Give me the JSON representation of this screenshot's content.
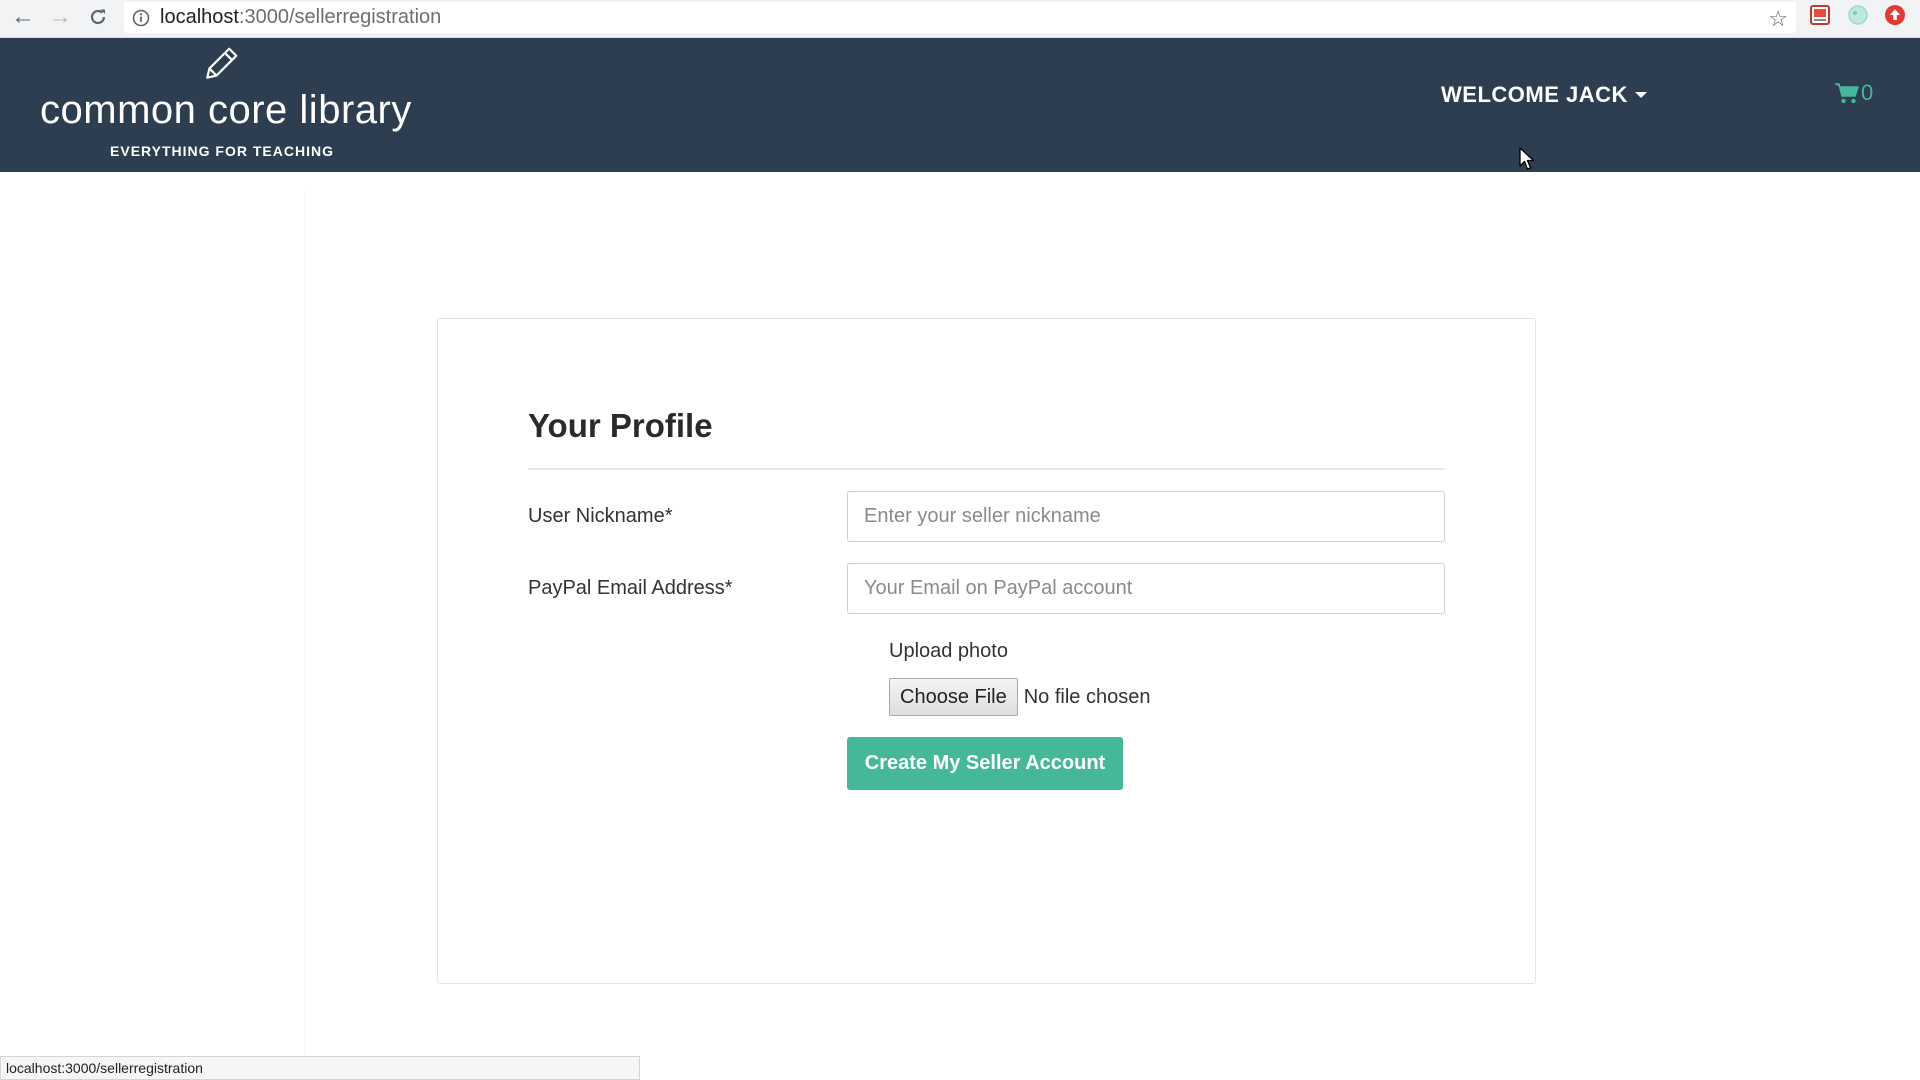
{
  "browser": {
    "url_host": "localhost",
    "url_path": ":3000/sellerregistration",
    "status_url": "localhost:3000/sellerregistration"
  },
  "header": {
    "logo_name": "common core library",
    "logo_tagline": "EVERYTHING FOR TEACHING",
    "welcome": "WELCOME JACK",
    "cart_count": "0"
  },
  "profile": {
    "title": "Your Profile",
    "nickname_label": "User Nickname*",
    "nickname_placeholder": "Enter your seller nickname",
    "email_label": "PayPal Email Address*",
    "email_placeholder": "Your Email on PayPal account",
    "upload_label": "Upload photo",
    "choose_file": "Choose File",
    "file_status": "No file chosen",
    "submit": "Create My Seller Account"
  },
  "colors": {
    "header_bg": "#2c3e50",
    "accent": "#45b89a"
  },
  "icons": {
    "back": "arrow-left-icon",
    "forward": "arrow-right-icon",
    "reload": "reload-icon",
    "info": "info-icon",
    "star": "star-icon",
    "logo": "pencil-icon",
    "cart": "cart-icon"
  }
}
